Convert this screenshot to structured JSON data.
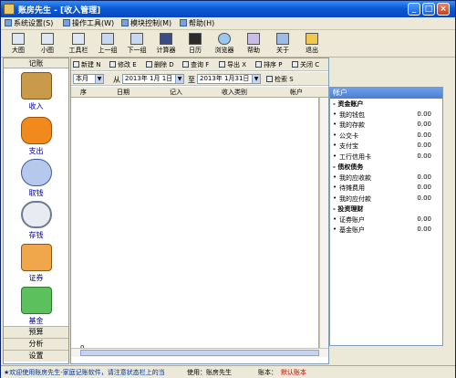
{
  "window": {
    "title": "账房先生 - [收入管理]"
  },
  "menu": [
    "系统设置(S)",
    "操作工具(W)",
    "模块控制(M)",
    "帮助(H)"
  ],
  "toolbar": [
    "大图",
    "小图",
    "工具栏",
    "上一组",
    "下一组",
    "计算器",
    "日历",
    "浏览器",
    "帮助",
    "关于",
    "退出"
  ],
  "left": {
    "header": "记账",
    "items": [
      "收入",
      "支出",
      "取钱",
      "存钱",
      "证券",
      "基金"
    ],
    "footer": [
      "预算",
      "分析",
      "设置"
    ]
  },
  "content_toolbar": [
    "新建 N",
    "修改 E",
    "删除 D",
    "查询 F",
    "导出 X",
    "排序 P",
    "关闭 C"
  ],
  "filter": {
    "period": "本月",
    "from_label": "从",
    "from_date": "2013年 1月 1日",
    "to_label": "至",
    "to_date": "2013年 1月31日",
    "search": "检索 S"
  },
  "table": {
    "columns": [
      "序",
      "日期",
      "记入",
      "收入类别",
      "帐户"
    ],
    "footer_value": "0"
  },
  "accounts": {
    "title": "帐户",
    "groups": [
      {
        "name": "资金账户",
        "items": [
          {
            "name": "我的钱包",
            "value": "0.00"
          },
          {
            "name": "我的存款",
            "value": "0.00"
          },
          {
            "name": "公交卡",
            "value": "0.00"
          },
          {
            "name": "支付宝",
            "value": "0.00"
          },
          {
            "name": "工行信用卡",
            "value": "0.00"
          }
        ]
      },
      {
        "name": "债权债务",
        "items": [
          {
            "name": "我的应收款",
            "value": "0.00"
          },
          {
            "name": "待摊费用",
            "value": "0.00"
          },
          {
            "name": "我的应付款",
            "value": "0.00"
          }
        ]
      },
      {
        "name": "投资理财",
        "items": [
          {
            "name": "证券账户",
            "value": "0.00"
          },
          {
            "name": "基金账户",
            "value": "0.00"
          }
        ]
      }
    ]
  },
  "status": {
    "marquee": "★欢迎使用账房先生-家庭记账软件，请注意状态栏上的当",
    "user": "使用：账房先生",
    "book_label": "账本：",
    "book_value": "默认账本"
  },
  "colors": {
    "title_bar": "#0a5ad6",
    "nav_label": "#00009c",
    "book_value": "#cc0000"
  }
}
